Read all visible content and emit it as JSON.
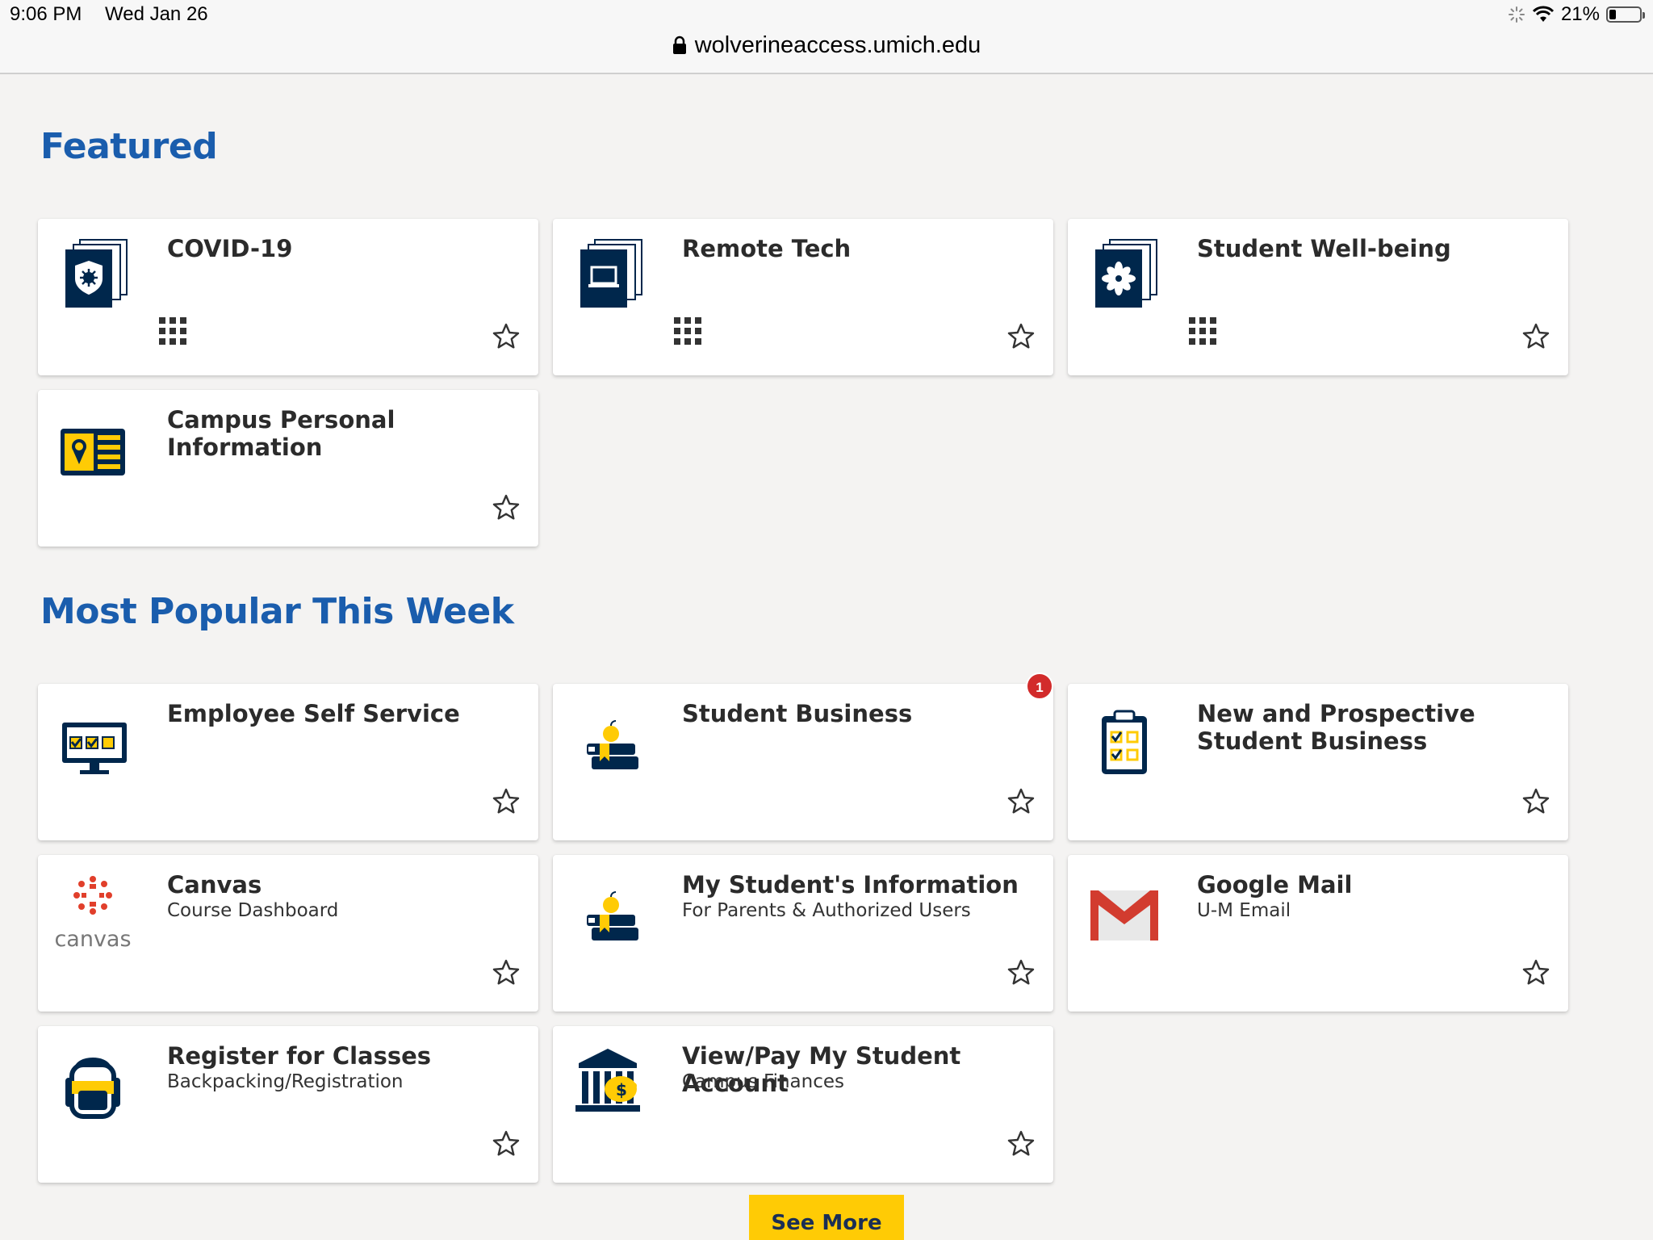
{
  "status": {
    "time": "9:06 PM",
    "date": "Wed Jan 26",
    "battery": "21%"
  },
  "browser": {
    "url": "wolverineaccess.umich.edu"
  },
  "sections": {
    "featured": "Featured",
    "popular": "Most Popular This Week"
  },
  "featured": [
    {
      "title": "COVID-19",
      "icon": "shield-virus-icon"
    },
    {
      "title": "Remote Tech",
      "icon": "laptop-icon"
    },
    {
      "title": "Student Well-being",
      "icon": "flower-icon"
    },
    {
      "title": "Campus Personal Information",
      "icon": "id-card-icon"
    }
  ],
  "popular": [
    {
      "title": "Employee Self Service",
      "icon": "monitor-checklist-icon"
    },
    {
      "title": "Student Business",
      "icon": "books-apple-icon",
      "badge": "1"
    },
    {
      "title": "New and Prospective Student Business",
      "icon": "clipboard-checklist-icon"
    },
    {
      "title": "Canvas",
      "subtitle": "Course Dashboard",
      "icon": "canvas-logo-icon",
      "logo_text": "canvas"
    },
    {
      "title": "My Student's Information",
      "subtitle": "For Parents & Authorized Users",
      "icon": "books-apple-icon"
    },
    {
      "title": "Google Mail",
      "subtitle": "U-M Email",
      "icon": "gmail-logo-icon"
    },
    {
      "title": "Register for Classes",
      "subtitle": "Backpacking/Registration",
      "icon": "backpack-icon"
    },
    {
      "title": "View/Pay My Student Account",
      "subtitle": "Campus Finances",
      "icon": "bank-piggy-icon"
    }
  ],
  "buttons": {
    "see_more": "See More"
  },
  "colors": {
    "heading": "#1a5dad",
    "navy": "#00274c",
    "maize": "#ffcb05",
    "badge": "#d22b2b"
  }
}
